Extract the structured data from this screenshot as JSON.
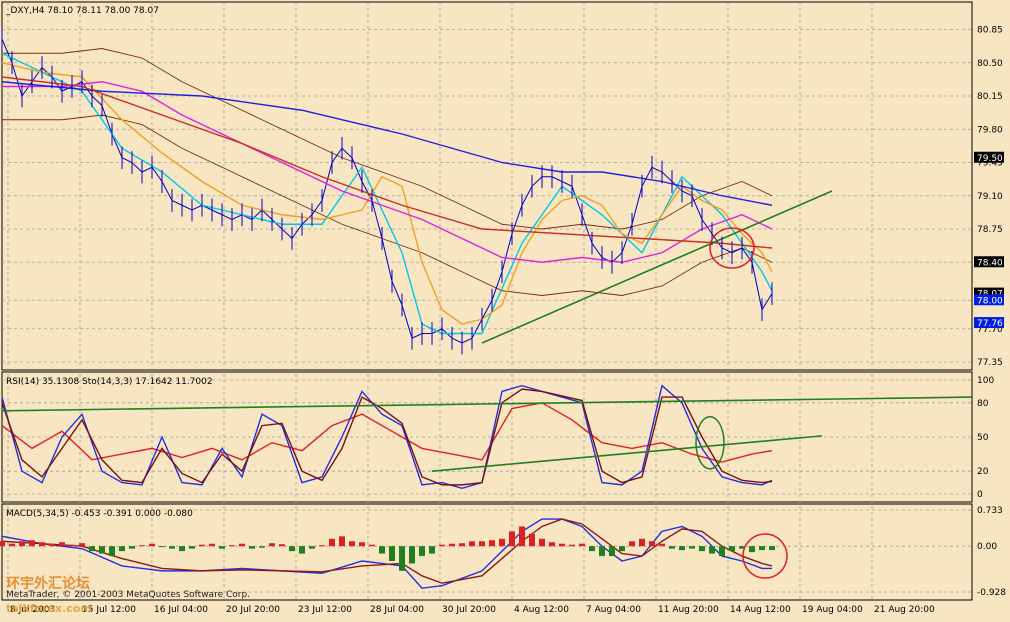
{
  "title": "_DXY,H4  78.10 78.11 78.00 78.07",
  "software": "MetaTrader, © 2001-2003 MetaQuotes Software Corp.",
  "watermark": "环宇外汇论坛 talkforex.com",
  "colors": {
    "background": "#f8e6c2",
    "grid": "#a0a0a0",
    "price_bar": "#0000c8",
    "cyan_ma": "#00c8e8",
    "orange_ma": "#f0a020",
    "magenta_ma": "#e020e0",
    "blue_ma": "#2020e0",
    "red_ma": "#c83020",
    "bollinger": "#7a2a10",
    "trend": "#208020",
    "hist_up": "#e02020",
    "hist_down": "#208020",
    "price_box": "#0020e0"
  },
  "x_axis": {
    "labels": [
      "8 Jul 2003",
      "15 Jul 12:00",
      "16 Jul 04:00",
      "20 Jul 20:00",
      "23 Jul 12:00",
      "28 Jul 04:00",
      "30 Jul 20:00",
      "4 Aug 12:00",
      "7 Aug 04:00",
      "11 Aug 20:00",
      "14 Aug 12:00",
      "19 Aug 04:00",
      "21 Aug 20:00"
    ]
  },
  "chart_data": [
    {
      "type": "line",
      "panel": "price",
      "title": "_DXY,H4  78.10 78.11 78.00 78.07",
      "ylim": [
        77.35,
        80.95
      ],
      "yticks": [
        "80.85",
        "80.50",
        "80.15",
        "79.80",
        "79.45",
        "79.10",
        "78.75",
        "78.40",
        "78.00",
        "77.70",
        "77.35"
      ],
      "price_labels": {
        "highlighted": [
          "79.50",
          "78.40",
          "78.07",
          "78.00",
          "77.76"
        ]
      },
      "ohlc": {
        "open": 78.1,
        "high": 78.11,
        "low": 78.0,
        "close": 78.07
      },
      "series": [
        {
          "role": "close",
          "color": "#0000c8",
          "x": [
            0,
            10,
            20,
            30,
            40,
            50,
            60,
            70,
            80,
            90,
            100,
            110,
            120,
            130,
            140,
            150,
            160,
            170,
            180,
            190,
            200,
            210,
            220,
            230,
            240,
            250,
            260,
            270,
            280,
            290,
            300,
            310,
            320,
            330,
            340,
            350,
            360,
            370,
            380,
            390,
            400,
            410,
            420,
            430,
            440,
            450,
            460,
            470,
            480,
            490,
            500,
            510,
            520,
            530,
            540,
            550,
            560,
            570,
            580,
            590,
            600,
            610,
            620,
            630,
            640,
            650,
            660,
            670,
            680,
            690,
            700,
            710,
            720,
            730,
            740,
            750,
            760,
            770
          ],
          "values": [
            80.75,
            80.5,
            80.15,
            80.3,
            80.45,
            80.35,
            80.2,
            80.25,
            80.3,
            80.15,
            80.05,
            79.75,
            79.5,
            79.45,
            79.35,
            79.4,
            79.25,
            79.05,
            79.0,
            78.95,
            79.0,
            78.95,
            78.9,
            78.85,
            78.9,
            78.85,
            78.95,
            78.85,
            78.75,
            78.65,
            78.8,
            78.9,
            79.05,
            79.45,
            79.6,
            79.5,
            79.25,
            79.05,
            78.65,
            78.2,
            77.95,
            77.6,
            77.65,
            77.65,
            77.7,
            77.6,
            77.55,
            77.6,
            77.8,
            78.0,
            78.3,
            78.7,
            79.0,
            79.2,
            79.3,
            79.3,
            79.25,
            79.2,
            78.9,
            78.6,
            78.45,
            78.4,
            78.5,
            78.8,
            79.2,
            79.4,
            79.35,
            79.25,
            79.15,
            79.1,
            78.85,
            78.7,
            78.55,
            78.5,
            78.55,
            78.4,
            77.9,
            78.07
          ]
        },
        {
          "role": "fast ma",
          "color": "#00c8e8",
          "x": [
            0,
            40,
            80,
            120,
            160,
            200,
            240,
            280,
            320,
            360,
            400,
            420,
            440,
            480,
            520,
            560,
            600,
            640,
            680,
            720,
            760,
            770
          ],
          "values": [
            80.6,
            80.4,
            80.2,
            79.6,
            79.35,
            79.0,
            78.9,
            78.8,
            78.8,
            79.4,
            78.5,
            77.75,
            77.65,
            77.65,
            78.6,
            79.2,
            78.9,
            78.5,
            79.3,
            78.9,
            78.3,
            78.1
          ]
        },
        {
          "role": "medium ma",
          "color": "#f0a020",
          "x": [
            0,
            40,
            80,
            120,
            160,
            200,
            240,
            280,
            320,
            360,
            380,
            400,
            420,
            440,
            460,
            480,
            500,
            520,
            540,
            560,
            580,
            600,
            620,
            640,
            660,
            680,
            700,
            720,
            740,
            760,
            770
          ],
          "values": [
            80.5,
            80.4,
            80.35,
            79.9,
            79.55,
            79.25,
            79.0,
            78.9,
            78.85,
            78.95,
            79.3,
            79.2,
            78.4,
            77.9,
            77.75,
            77.8,
            77.95,
            78.5,
            78.85,
            79.05,
            79.1,
            79.0,
            78.7,
            78.6,
            78.9,
            79.2,
            79.05,
            78.95,
            78.7,
            78.5,
            78.3
          ]
        },
        {
          "role": "slow ma",
          "color": "#e020e0",
          "x": [
            0,
            60,
            100,
            140,
            180,
            220,
            260,
            300,
            340,
            380,
            420,
            460,
            500,
            540,
            580,
            620,
            660,
            700,
            740,
            760,
            770
          ],
          "values": [
            80.25,
            80.25,
            80.3,
            80.2,
            79.95,
            79.75,
            79.55,
            79.35,
            79.15,
            79.0,
            78.85,
            78.65,
            78.45,
            78.4,
            78.45,
            78.4,
            78.5,
            78.75,
            78.9,
            78.8,
            78.75
          ]
        },
        {
          "role": "long ma",
          "color": "#2020e0",
          "x": [
            0,
            100,
            200,
            300,
            400,
            500,
            560,
            600,
            660,
            720,
            770
          ],
          "values": [
            80.3,
            80.2,
            80.15,
            80.0,
            79.75,
            79.45,
            79.35,
            79.35,
            79.25,
            79.1,
            79.0
          ]
        },
        {
          "role": "mid ma",
          "color": "#c83020",
          "x": [
            0,
            80,
            160,
            240,
            320,
            400,
            480,
            560,
            640,
            720,
            770
          ],
          "values": [
            80.35,
            80.25,
            79.95,
            79.65,
            79.3,
            79.0,
            78.75,
            78.7,
            78.65,
            78.6,
            78.55
          ]
        }
      ],
      "trendlines": [
        {
          "x": [
            480,
            830
          ],
          "values": [
            77.55,
            79.15
          ]
        }
      ]
    },
    {
      "type": "line",
      "panel": "rsi",
      "title": "RSI(14) 35.1308  Sto(14,3,3) 17.1642 11.7002",
      "ylim": [
        0,
        100
      ],
      "yticks": [
        "100",
        "80",
        "50",
        "20",
        "0"
      ],
      "series": [
        {
          "role": "rsi",
          "color": "#e02020",
          "x": [
            0,
            30,
            60,
            90,
            120,
            150,
            180,
            210,
            240,
            270,
            300,
            330,
            360,
            390,
            420,
            450,
            480,
            510,
            540,
            570,
            600,
            630,
            660,
            690,
            720,
            750,
            770
          ],
          "values": [
            60,
            40,
            55,
            30,
            35,
            40,
            32,
            40,
            30,
            45,
            38,
            60,
            70,
            55,
            40,
            35,
            30,
            75,
            80,
            65,
            45,
            40,
            45,
            35,
            28,
            35,
            38
          ]
        },
        {
          "role": "sto main",
          "color": "#2030e0",
          "x": [
            0,
            20,
            40,
            60,
            80,
            100,
            120,
            140,
            160,
            180,
            200,
            220,
            240,
            260,
            280,
            300,
            320,
            340,
            360,
            380,
            400,
            420,
            440,
            460,
            480,
            500,
            520,
            540,
            560,
            580,
            600,
            620,
            640,
            660,
            680,
            700,
            720,
            740,
            760,
            770
          ],
          "values": [
            85,
            20,
            10,
            50,
            70,
            20,
            10,
            8,
            50,
            10,
            8,
            40,
            15,
            70,
            60,
            10,
            15,
            50,
            90,
            70,
            60,
            8,
            10,
            5,
            10,
            90,
            95,
            90,
            85,
            80,
            10,
            8,
            20,
            95,
            80,
            40,
            15,
            10,
            8,
            12
          ]
        },
        {
          "role": "sto signal",
          "color": "#7a1010",
          "x": [
            0,
            20,
            40,
            60,
            80,
            100,
            120,
            140,
            160,
            180,
            200,
            220,
            240,
            260,
            280,
            300,
            320,
            340,
            360,
            380,
            400,
            420,
            440,
            460,
            480,
            500,
            520,
            540,
            560,
            580,
            600,
            620,
            640,
            660,
            680,
            700,
            720,
            740,
            760,
            770
          ],
          "values": [
            80,
            30,
            15,
            40,
            65,
            30,
            12,
            10,
            40,
            18,
            10,
            35,
            20,
            60,
            62,
            20,
            12,
            40,
            85,
            75,
            62,
            15,
            8,
            8,
            10,
            80,
            92,
            90,
            86,
            82,
            20,
            10,
            15,
            85,
            85,
            50,
            20,
            12,
            10,
            11
          ]
        }
      ],
      "trendlines": [
        {
          "x": [
            0,
            970
          ],
          "values": [
            73,
            85
          ]
        },
        {
          "x": [
            430,
            820
          ],
          "values": [
            20,
            51
          ]
        }
      ]
    },
    {
      "type": "bar",
      "panel": "macd",
      "title": "MACD(5,34,5) -0.453 -0.391 0.000 -0.080",
      "ylim": [
        -0.928,
        0.733
      ],
      "yticks": [
        "0.733",
        "0.00",
        "-0.928"
      ],
      "hist_x": [
        0,
        10,
        20,
        30,
        40,
        50,
        60,
        70,
        80,
        90,
        100,
        110,
        120,
        130,
        140,
        150,
        160,
        170,
        180,
        190,
        200,
        210,
        220,
        230,
        240,
        250,
        260,
        270,
        280,
        290,
        300,
        310,
        320,
        330,
        340,
        350,
        360,
        370,
        380,
        390,
        400,
        410,
        420,
        430,
        440,
        450,
        460,
        470,
        480,
        490,
        500,
        510,
        520,
        530,
        540,
        550,
        560,
        570,
        580,
        590,
        600,
        610,
        620,
        630,
        640,
        650,
        660,
        670,
        680,
        690,
        700,
        710,
        720,
        730,
        740,
        750,
        760,
        770
      ],
      "hist_values": [
        0.1,
        0.05,
        0.1,
        0.12,
        0.08,
        0.05,
        0.08,
        0.03,
        0.06,
        -0.1,
        -0.15,
        -0.2,
        -0.1,
        -0.05,
        0.02,
        0.05,
        -0.02,
        -0.05,
        -0.1,
        -0.05,
        0.03,
        0.05,
        -0.05,
        0.02,
        0.05,
        -0.05,
        -0.03,
        0.06,
        0.04,
        -0.1,
        -0.15,
        -0.05,
        0.02,
        0.15,
        0.2,
        0.1,
        0.08,
        0.03,
        -0.15,
        -0.3,
        -0.5,
        -0.35,
        -0.2,
        -0.15,
        0.03,
        0.05,
        0.06,
        0.1,
        0.1,
        0.12,
        0.15,
        0.3,
        0.4,
        0.25,
        0.15,
        0.08,
        0.05,
        0.03,
        0.05,
        -0.1,
        -0.2,
        -0.2,
        -0.1,
        0.1,
        0.15,
        0.1,
        0.05,
        -0.05,
        -0.08,
        -0.05,
        -0.1,
        -0.15,
        -0.2,
        -0.1,
        -0.05,
        -0.12,
        -0.08,
        -0.08
      ],
      "series": [
        {
          "role": "macd",
          "color": "#2030e0",
          "x": [
            0,
            40,
            80,
            120,
            160,
            200,
            240,
            280,
            320,
            360,
            400,
            420,
            440,
            480,
            520,
            540,
            560,
            580,
            600,
            620,
            640,
            660,
            680,
            700,
            720,
            740,
            760,
            770
          ],
          "values": [
            0.2,
            0.05,
            -0.05,
            -0.4,
            -0.5,
            -0.5,
            -0.45,
            -0.5,
            -0.55,
            -0.3,
            -0.4,
            -0.85,
            -0.8,
            -0.5,
            0.3,
            0.55,
            0.55,
            0.4,
            0.0,
            -0.3,
            -0.2,
            0.3,
            0.4,
            0.2,
            -0.2,
            -0.3,
            -0.45,
            -0.45
          ]
        },
        {
          "role": "signal",
          "color": "#8b1a1a",
          "x": [
            0,
            40,
            80,
            120,
            160,
            200,
            240,
            280,
            320,
            360,
            400,
            420,
            440,
            480,
            520,
            540,
            560,
            580,
            600,
            620,
            640,
            660,
            680,
            700,
            720,
            740,
            760,
            770
          ],
          "values": [
            0.1,
            0.05,
            0.0,
            -0.25,
            -0.45,
            -0.5,
            -0.48,
            -0.5,
            -0.52,
            -0.4,
            -0.35,
            -0.6,
            -0.75,
            -0.6,
            0.1,
            0.4,
            0.55,
            0.45,
            0.15,
            -0.15,
            -0.2,
            0.1,
            0.35,
            0.3,
            0.0,
            -0.2,
            -0.35,
            -0.4
          ]
        }
      ]
    }
  ]
}
